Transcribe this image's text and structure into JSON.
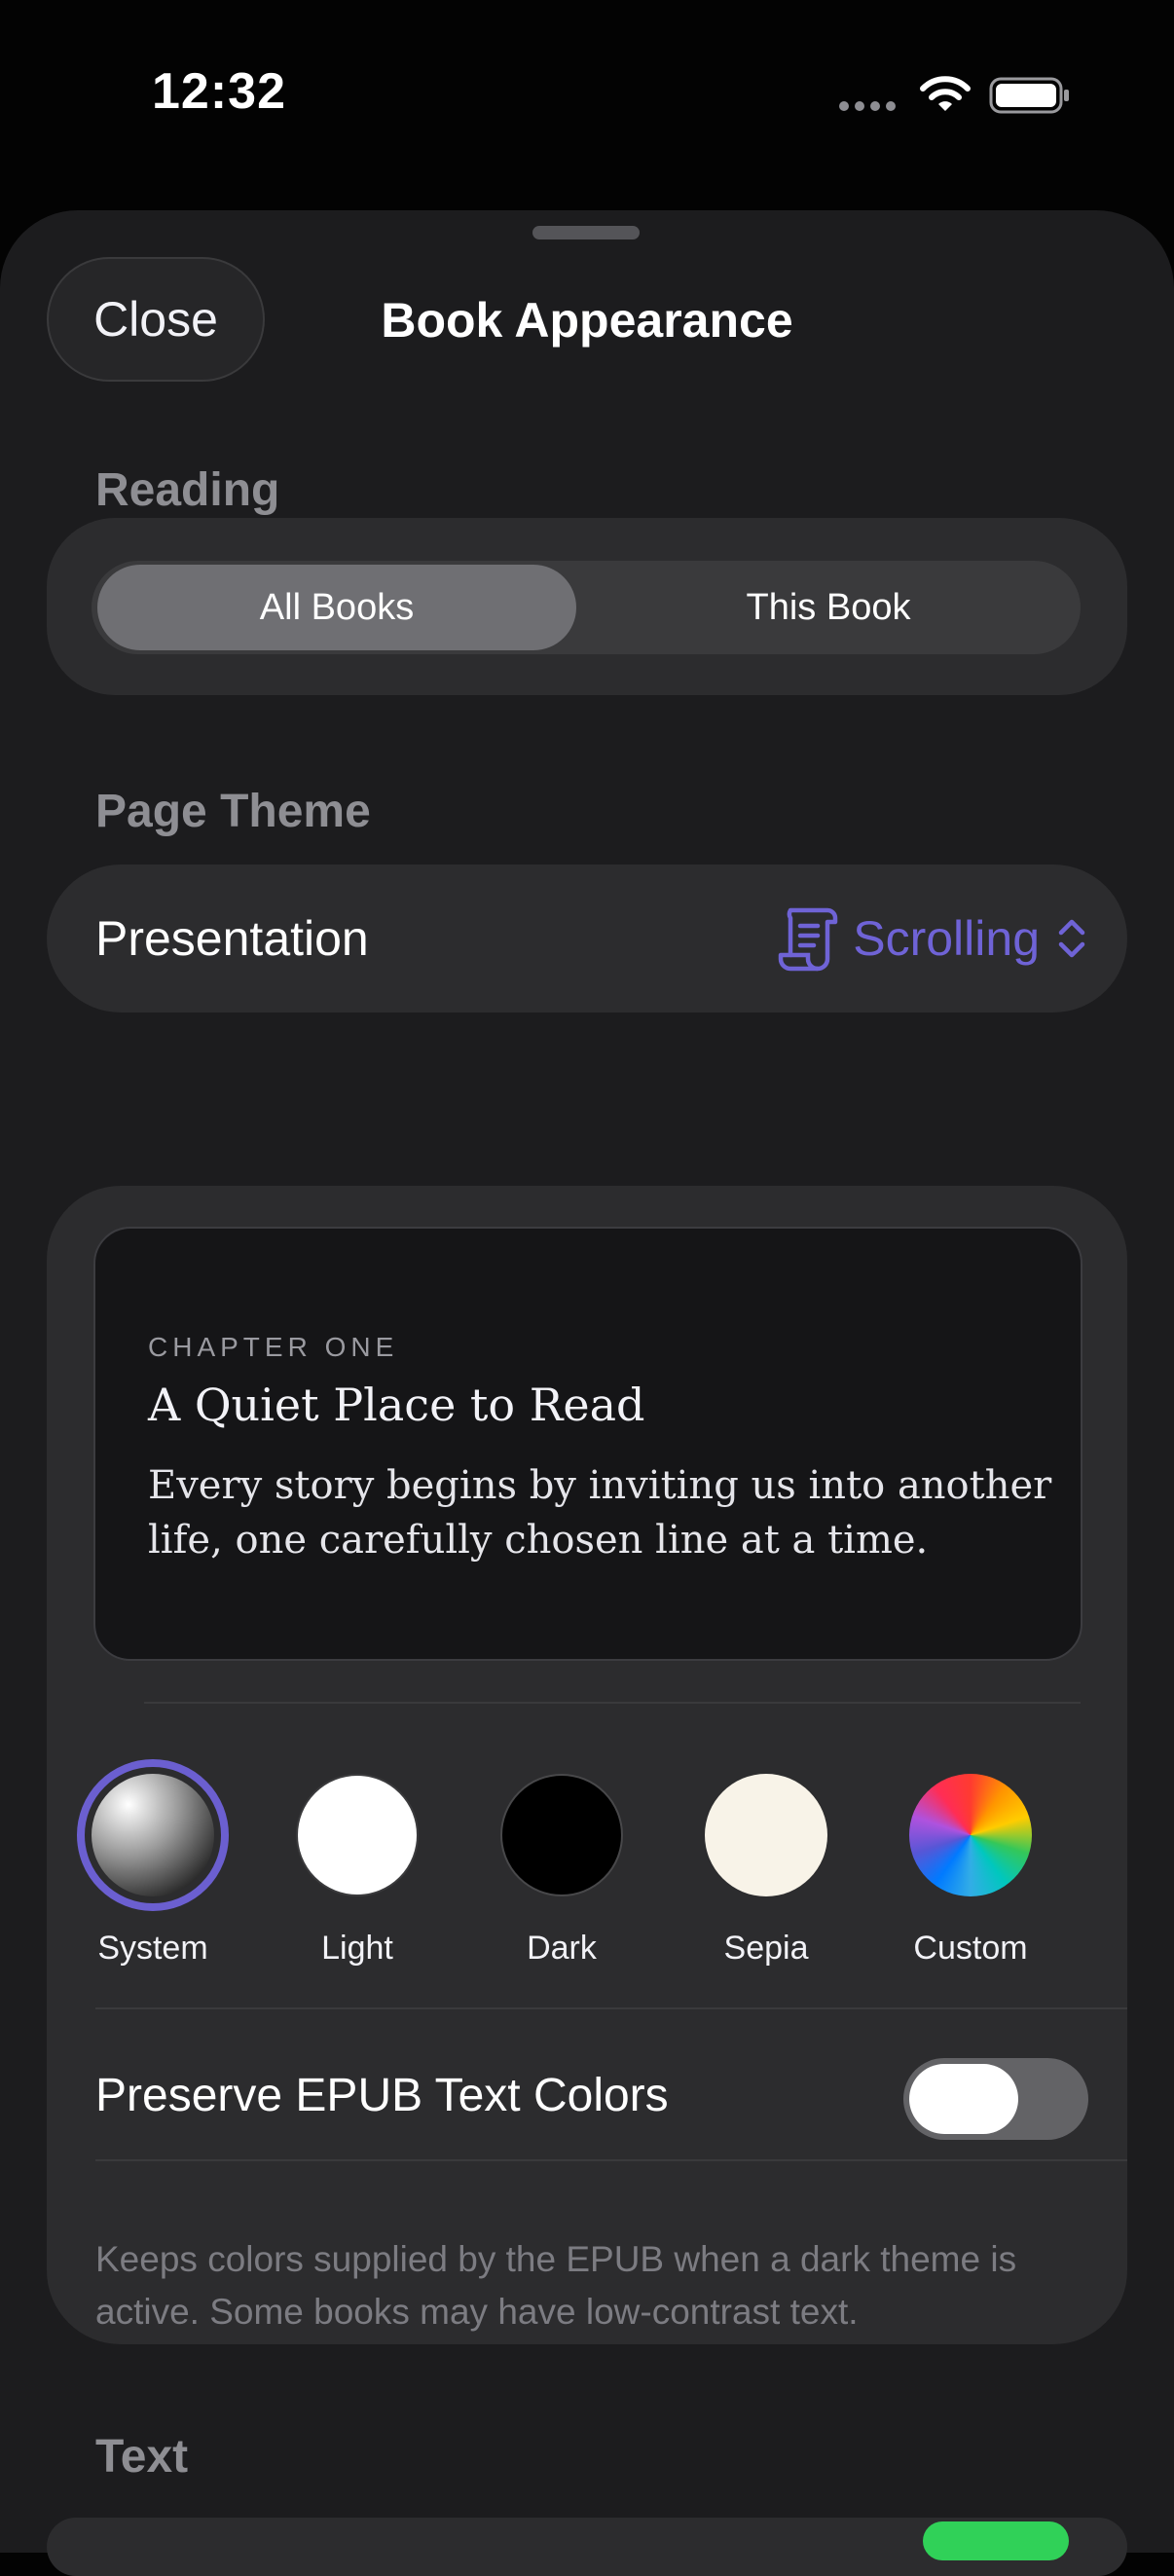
{
  "status_bar": {
    "time": "12:32"
  },
  "sheet": {
    "close_label": "Close",
    "title": "Book Appearance"
  },
  "scope": {
    "options": [
      "All Books",
      "This Book"
    ],
    "selected": "All Books"
  },
  "reading": {
    "header": "Reading",
    "presentation_label": "Presentation",
    "presentation_value": "Scrolling",
    "accent_color": "#6f63d6"
  },
  "page_theme": {
    "header": "Page Theme",
    "preview": {
      "overline": "CHAPTER ONE",
      "title": "A Quiet Place to Read",
      "body": "Every story begins by inviting us into another life, one carefully chosen line at a time."
    },
    "themes": [
      {
        "label": "System",
        "selected": true,
        "icon": "gradient-circle"
      },
      {
        "label": "Light",
        "color": "#ffffff"
      },
      {
        "label": "Dark",
        "color": "#000000"
      },
      {
        "label": "Sepia",
        "color": "#f8f3e8"
      },
      {
        "label": "Custom",
        "icon": "color-wheel"
      }
    ],
    "preserve_label": "Preserve EPUB Text Colors",
    "preserve_enabled": false,
    "footnote": "Keeps colors supplied by the EPUB when a dark theme is active. Some books may have low-contrast text."
  },
  "text": {
    "header": "Text"
  }
}
